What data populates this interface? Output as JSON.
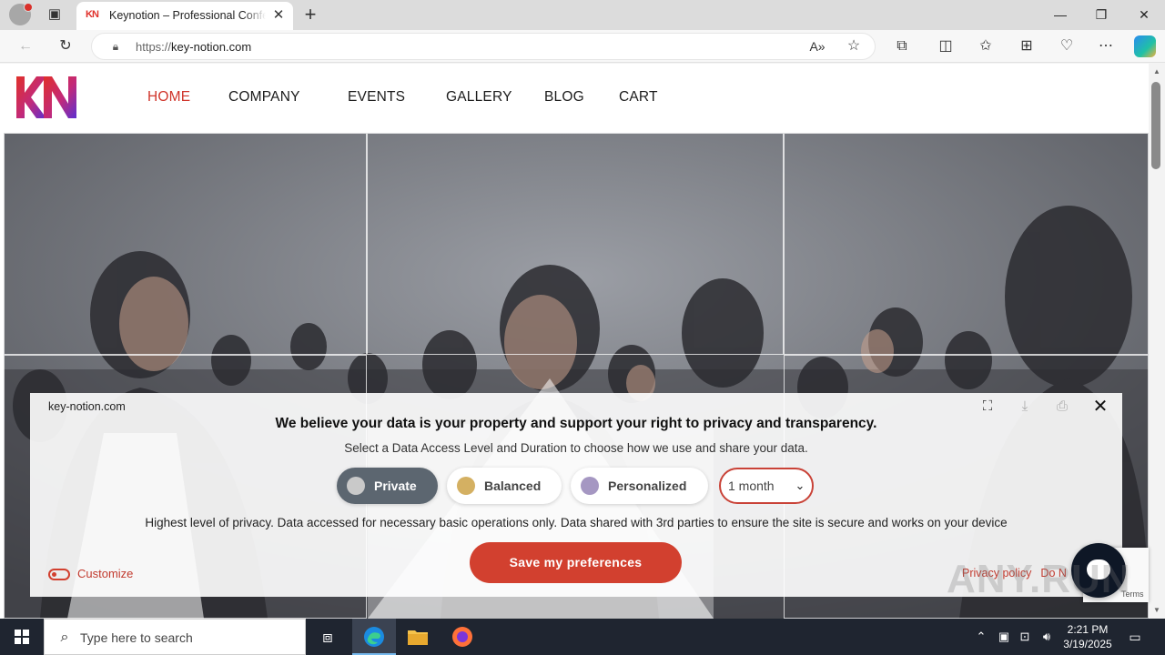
{
  "browser": {
    "tab_title": "Keynotion – Professional Conferences",
    "tab_favicon": "KN",
    "url_scheme": "https://",
    "url_host": "key-notion.com",
    "icons": [
      "profile-icon",
      "tab-actions-icon",
      "close-tab-icon",
      "new-tab-icon",
      "back-icon",
      "refresh-icon",
      "lock-icon",
      "read-aloud-icon",
      "favorite-star-icon",
      "extensions-icon",
      "split-screen-icon",
      "favorites-icon",
      "collections-icon",
      "performance-icon",
      "more-icon",
      "copilot-icon",
      "minimize-icon",
      "restore-icon",
      "close-window-icon"
    ]
  },
  "site": {
    "nav": [
      {
        "label": "HOME",
        "active": true
      },
      {
        "label": "COMPANY",
        "active": false
      },
      {
        "label": "EVENTS",
        "active": false
      },
      {
        "label": "GALLERY",
        "active": false
      },
      {
        "label": "BLOG",
        "active": false
      },
      {
        "label": "CART",
        "active": false
      }
    ],
    "colors": {
      "accent": "#d0352b",
      "brand_gradient": [
        "#e0302a",
        "#6a2fd0"
      ]
    }
  },
  "consent": {
    "domain": "key-notion.com",
    "headline": "We believe your data is your property and support your right to privacy and transparency.",
    "subtitle": "Select a Data Access Level and Duration to choose how we use and share your data.",
    "levels": [
      {
        "label": "Private",
        "selected": true,
        "dot_color": "#c9c9c9"
      },
      {
        "label": "Balanced",
        "selected": false,
        "dot_color": "#d4b062"
      },
      {
        "label": "Personalized",
        "selected": false,
        "dot_color": "#a597c2"
      }
    ],
    "duration": "1 month",
    "description": "Highest level of privacy. Data accessed for necessary basic operations only. Data shared with 3rd parties to ensure the site is secure and works on your device",
    "save_label": "Save my preferences",
    "customize_label": "Customize",
    "privacy_policy_label": "Privacy policy",
    "do_not_sell_label": "Do N",
    "icons": [
      "fullscreen-icon",
      "download-icon",
      "print-icon",
      "close-icon"
    ]
  },
  "overlay": {
    "recaptcha_terms": "Terms",
    "watermark": "ANY.RUN"
  },
  "taskbar": {
    "search_placeholder": "Type here to search",
    "time": "2:21 PM",
    "date": "3/19/2025"
  }
}
